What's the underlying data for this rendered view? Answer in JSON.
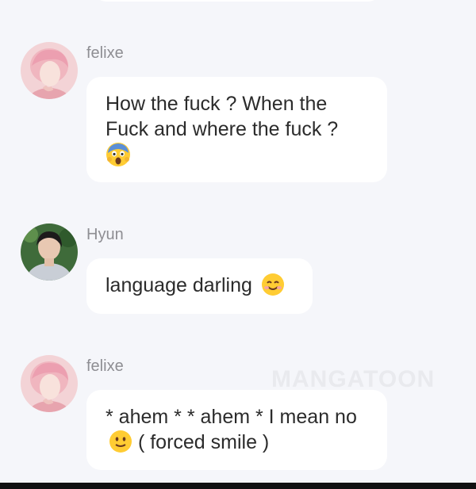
{
  "messages": [
    {
      "sender": "felixe",
      "text": "How the fuck ? When the Fuck and where the fuck ?",
      "emoji": "screaming-face"
    },
    {
      "sender": "Hyun",
      "text": "language darling",
      "emoji": "smiling-face"
    },
    {
      "sender": "felixe",
      "text": "* ahem * * ahem * I mean no",
      "emoji": "slightly-smiling-face",
      "text_after": "( forced smile )"
    }
  ],
  "watermark": "MANGATOON",
  "colors": {
    "background": "#f5f6fa",
    "bubble": "#ffffff",
    "username": "#8e8e93",
    "text": "#2b2b2b"
  }
}
